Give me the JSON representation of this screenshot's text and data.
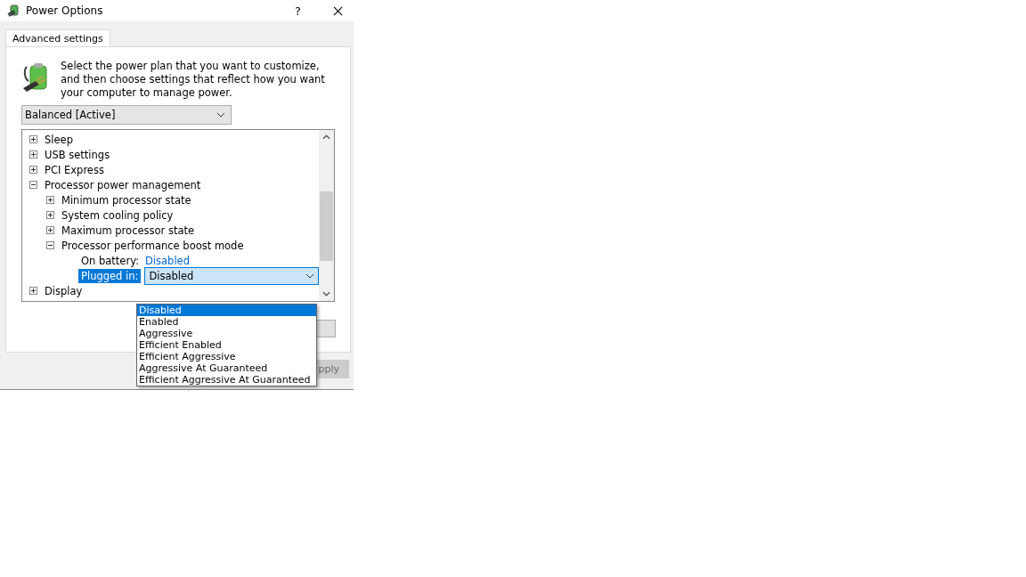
{
  "window": {
    "title": "Power Options",
    "help": "?"
  },
  "tabs": [
    {
      "label": "Advanced settings",
      "selected": true
    }
  ],
  "description": "Select the power plan that you want to customize, and then choose settings that reflect how you want your computer to manage power.",
  "plan_select": {
    "value": "Balanced [Active]"
  },
  "tree": [
    {
      "label": "Sleep",
      "expanded": false
    },
    {
      "label": "USB settings",
      "expanded": false
    },
    {
      "label": "PCI Express",
      "expanded": false
    },
    {
      "label": "Processor power management",
      "expanded": true,
      "children": [
        {
          "label": "Minimum processor state",
          "expanded": false
        },
        {
          "label": "System cooling policy",
          "expanded": false
        },
        {
          "label": "Maximum processor state",
          "expanded": false
        },
        {
          "label": "Processor performance boost mode",
          "expanded": true,
          "settings": [
            {
              "label": "On battery:",
              "value": "Disabled",
              "selected": false
            },
            {
              "label": "Plugged in:",
              "value": "Disabled",
              "selected": true
            }
          ]
        }
      ]
    },
    {
      "label": "Display",
      "expanded": false
    }
  ],
  "dropdown_options": [
    {
      "label": "Disabled",
      "selected": true
    },
    {
      "label": "Enabled",
      "selected": false
    },
    {
      "label": "Aggressive",
      "selected": false
    },
    {
      "label": "Efficient Enabled",
      "selected": false
    },
    {
      "label": "Efficient Aggressive",
      "selected": false
    },
    {
      "label": "Aggressive At Guaranteed",
      "selected": false
    },
    {
      "label": "Efficient Aggressive At Guaranteed",
      "selected": false
    }
  ],
  "apply_button": {
    "label": "pply",
    "disabled": true
  }
}
